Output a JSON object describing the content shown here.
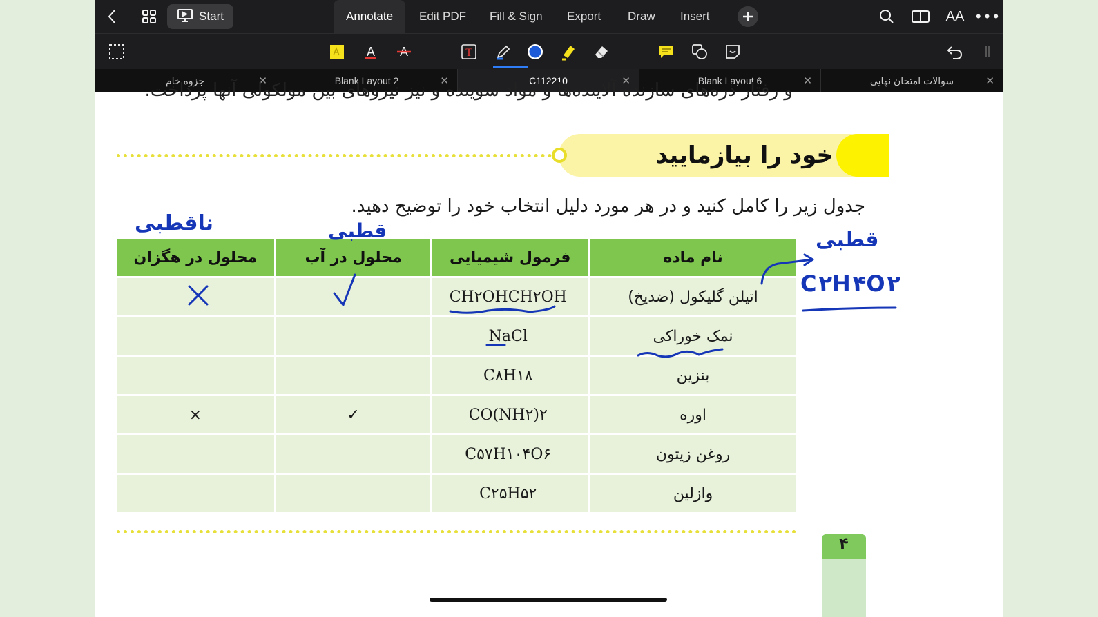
{
  "topbar": {
    "start_label": "Start",
    "tabs": [
      {
        "label": "Annotate",
        "active": true
      },
      {
        "label": "Edit PDF"
      },
      {
        "label": "Fill & Sign"
      },
      {
        "label": "Export"
      },
      {
        "label": "Draw"
      },
      {
        "label": "Insert"
      }
    ],
    "icons": [
      "back-icon",
      "grid-icon",
      "presentation-icon",
      "plus-icon",
      "search-icon",
      "book-icon",
      "text-size-icon",
      "more-icon"
    ],
    "text_size_label": "AA"
  },
  "toolbar": {
    "tools": [
      "select-icon",
      "sticky-highlight-icon",
      "text-color-icon",
      "strikethrough-icon",
      "textbox-icon",
      "pen-icon",
      "color-circle-icon",
      "highlighter-icon",
      "eraser-icon",
      "comment-icon",
      "shapes-icon",
      "sticker-icon",
      "undo-icon"
    ],
    "pen_color": "#1d5ad7",
    "text_letter": "A",
    "textbox_letter": "T"
  },
  "doc_tabs": [
    {
      "label": "جزوه خام"
    },
    {
      "label": "Blank Layout 2"
    },
    {
      "label": "C112210",
      "active": true
    },
    {
      "label": "Blank Layout 6"
    },
    {
      "label": "سوالات امتحان نهایی"
    }
  ],
  "page": {
    "cut_line": "و رفتار ذره‌های سازنده آلاینده‌ها و مواد شوینده و نیز نیروهای بین مولکولی آنها پرداخت.",
    "heading": "خود را بیازمایید",
    "instruction": "جدول زیر را کامل کنید و در هر مورد دلیل انتخاب خود را توضیح دهید.",
    "table": {
      "headers": [
        "نام ماده",
        "فرمول شیمیایی",
        "محلول در آب",
        "محلول در هگزان"
      ],
      "rows": [
        {
          "name": "اتیلن گلیکول (ضدیخ)",
          "formula": "CH۲OHCH۲OH",
          "water": "",
          "hexane": ""
        },
        {
          "name": "نمک خوراکی",
          "formula": "NaCl",
          "water": "",
          "hexane": ""
        },
        {
          "name": "بنزین",
          "formula": "C۸H۱۸",
          "water": "",
          "hexane": ""
        },
        {
          "name": "اوره",
          "formula": "CO(NH۲)۲",
          "water": "✓",
          "hexane": "×"
        },
        {
          "name": "روغن زیتون",
          "formula": "C۵۷H۱۰۴O۶",
          "water": "",
          "hexane": ""
        },
        {
          "name": "وازلین",
          "formula": "C۲۵H۵۲",
          "water": "",
          "hexane": ""
        }
      ]
    },
    "page_number": "۴"
  },
  "annotations": {
    "ink_color": "#1636b8",
    "nonpolar_note": "ناقطبی",
    "polar_note_water": "قطبی",
    "polar_note_side": "قطبی",
    "side_formula": "C۲H۴O۲",
    "check": "✓",
    "cross": "✕"
  }
}
